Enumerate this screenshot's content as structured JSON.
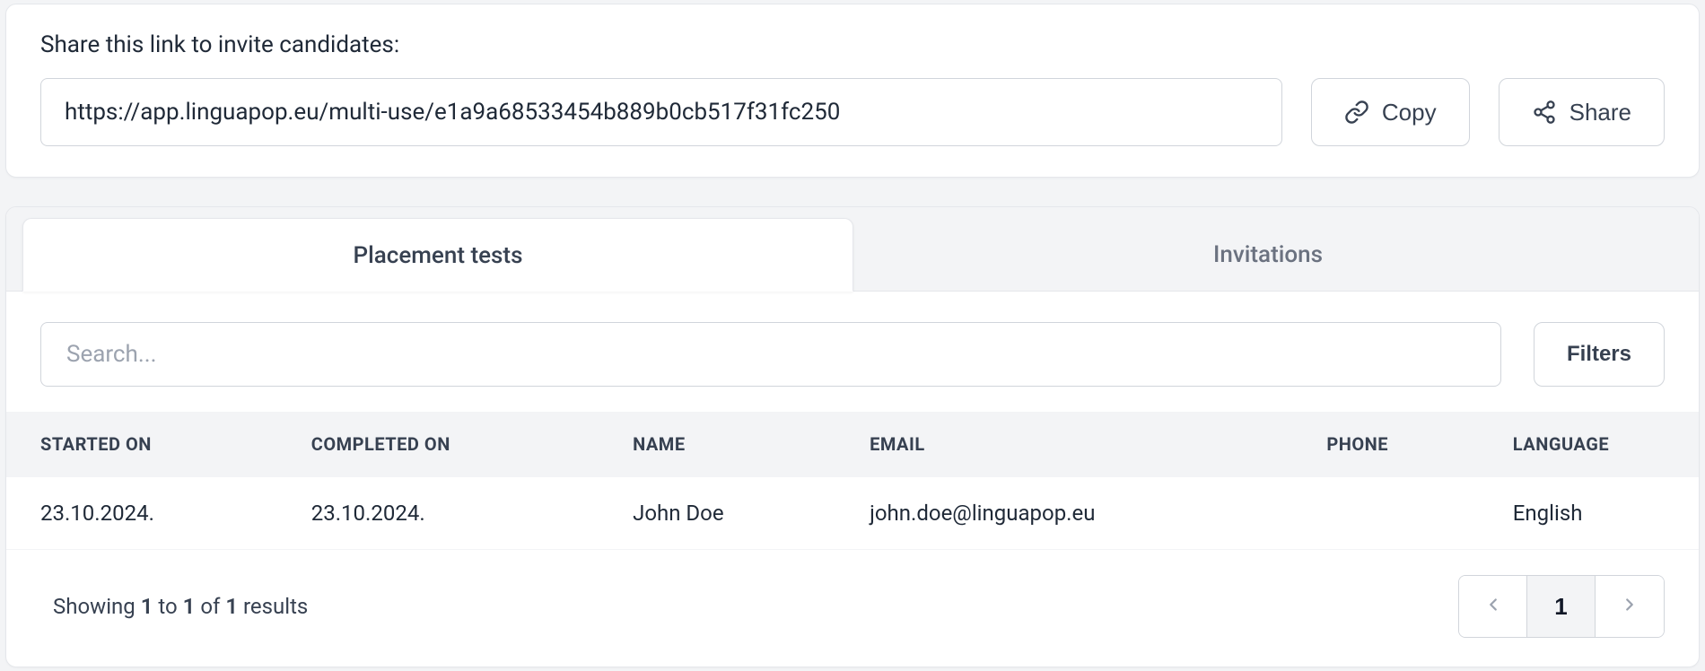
{
  "share": {
    "title": "Share this link to invite candidates:",
    "link": "https://app.linguapop.eu/multi-use/e1a9a68533454b889b0cb517f31fc250",
    "copy_label": "Copy",
    "share_label": "Share"
  },
  "tabs": {
    "items": [
      {
        "label": "Placement tests",
        "active": true
      },
      {
        "label": "Invitations",
        "active": false
      }
    ]
  },
  "search": {
    "placeholder": "Search...",
    "filters_label": "Filters"
  },
  "table": {
    "columns": [
      "STARTED ON",
      "COMPLETED ON",
      "NAME",
      "EMAIL",
      "PHONE",
      "LANGUAGE"
    ],
    "rows": [
      {
        "started_on": "23.10.2024.",
        "completed_on": "23.10.2024.",
        "name": "John Doe",
        "email": "john.doe@linguapop.eu",
        "phone": "",
        "language": "English"
      }
    ]
  },
  "pagination": {
    "showing_prefix": "Showing ",
    "from": "1",
    "to_word": " to ",
    "to": "1",
    "of_word": " of ",
    "total": "1",
    "results_word": " results",
    "current_page": "1"
  }
}
